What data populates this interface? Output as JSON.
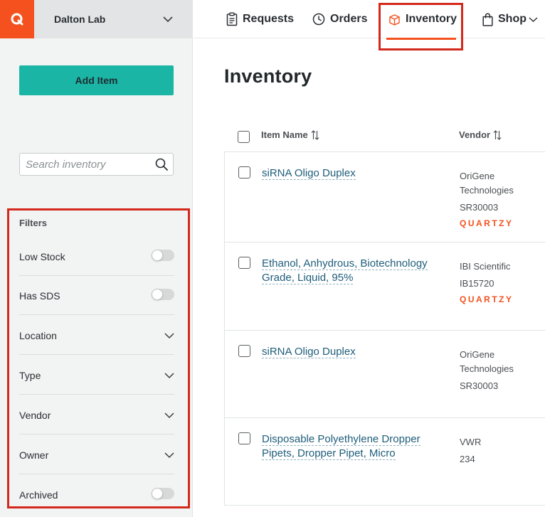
{
  "sidebar": {
    "lab_name": "Dalton Lab",
    "add_item_label": "Add Item",
    "search_placeholder": "Search inventory",
    "filters_title": "Filters",
    "filters": [
      {
        "label": "Low Stock",
        "control": "toggle",
        "on": false
      },
      {
        "label": "Has SDS",
        "control": "toggle",
        "on": false
      },
      {
        "label": "Location",
        "control": "dropdown"
      },
      {
        "label": "Type",
        "control": "dropdown"
      },
      {
        "label": "Vendor",
        "control": "dropdown"
      },
      {
        "label": "Owner",
        "control": "dropdown"
      },
      {
        "label": "Archived",
        "control": "toggle",
        "on": false
      }
    ]
  },
  "nav": {
    "items": [
      {
        "label": "Requests",
        "icon": "clipboard-icon"
      },
      {
        "label": "Orders",
        "icon": "clock-icon"
      },
      {
        "label": "Inventory",
        "icon": "box-icon",
        "active": true
      },
      {
        "label": "Shop",
        "icon": "shopping-bag-icon"
      }
    ]
  },
  "main": {
    "title": "Inventory",
    "columns": [
      "Item Name",
      "Vendor"
    ],
    "rows": [
      {
        "name": "siRNA Oligo Duplex",
        "vendor": "OriGene Technologies",
        "catalog": "SR30003",
        "badge": "QUARTZY"
      },
      {
        "name": "Ethanol, Anhydrous, Biotechnology Grade, Liquid, 95%",
        "vendor": "IBI Scientific",
        "catalog": "IB15720",
        "badge": "QUARTZY"
      },
      {
        "name": "siRNA Oligo Duplex",
        "vendor": "OriGene Technologies",
        "catalog": "SR30003",
        "badge": ""
      },
      {
        "name": "Disposable Polyethylene Dropper Pipets, Dropper Pipet, Micro",
        "vendor": "VWR",
        "catalog": "234",
        "badge": ""
      }
    ]
  },
  "colors": {
    "brand_orange": "#f4511e",
    "primary_button": "#1bb5a5",
    "highlight_red": "#d3291c",
    "link_blue": "#1e5d7a"
  }
}
